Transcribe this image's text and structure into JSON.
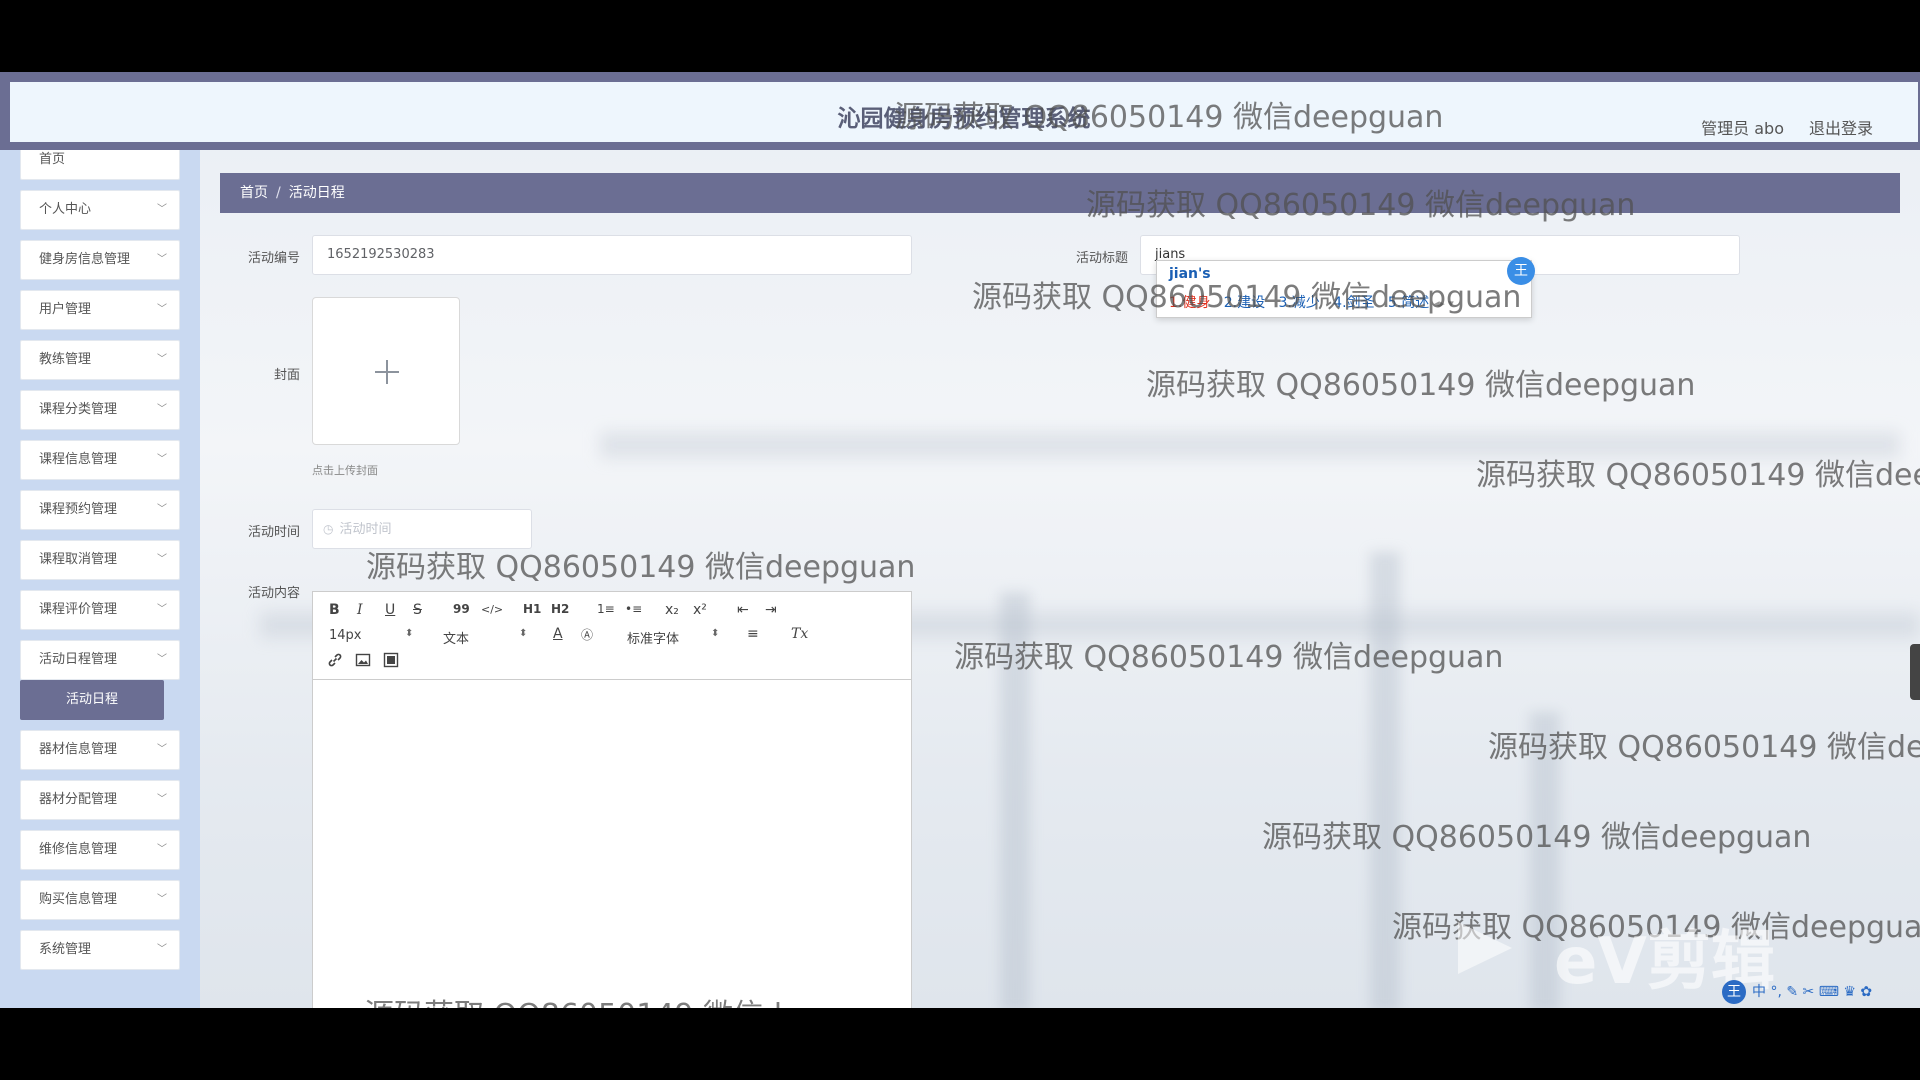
{
  "header": {
    "title": "沁园健身房预约管理系统",
    "user": "管理员 abo",
    "logout": "退出登录"
  },
  "sidebar": {
    "items": [
      {
        "label": "首页"
      },
      {
        "label": "个人中心"
      },
      {
        "label": "健身房信息管理"
      },
      {
        "label": "用户管理"
      },
      {
        "label": "教练管理"
      },
      {
        "label": "课程分类管理"
      },
      {
        "label": "课程信息管理"
      },
      {
        "label": "课程预约管理"
      },
      {
        "label": "课程取消管理"
      },
      {
        "label": "课程评价管理"
      },
      {
        "label": "活动日程管理"
      },
      {
        "label": "器材信息管理"
      },
      {
        "label": "器材分配管理"
      },
      {
        "label": "维修信息管理"
      },
      {
        "label": "购买信息管理"
      },
      {
        "label": "系统管理"
      }
    ],
    "active_sub": "活动日程"
  },
  "breadcrumb": {
    "home": "首页",
    "sep": "/",
    "current": "活动日程"
  },
  "form": {
    "id_label": "活动编号",
    "id_value": "1652192530283",
    "title_label": "活动标题",
    "title_value": "jians",
    "cover_label": "封面",
    "cover_hint": "点击上传封面",
    "time_label": "活动时间",
    "time_placeholder": "活动时间",
    "content_label": "活动内容"
  },
  "editor": {
    "font_size": "14px",
    "block_format": "文本",
    "font_family": "标准字体",
    "tools": [
      "B",
      "I",
      "U",
      "S",
      "99",
      "</>",
      "H1",
      "H2",
      "1≡",
      "•≡",
      "x₂",
      "x²",
      "⇤",
      "⇥",
      "A",
      "Ⓐ",
      "≡",
      "Tx",
      "link",
      "image",
      "video"
    ]
  },
  "ime": {
    "pinyin": "jian's",
    "candidates": [
      "1.健身",
      "2.建设",
      "3.减少",
      "4.剑圣",
      "5.简述"
    ],
    "badge": "王",
    "bar": "中 °, ✎ ✂ ⌨ ♛ ✿"
  },
  "watermark": "源码获取 QQ86050149 微信deepguan",
  "overlay_logo": "eV剪辑",
  "colors": {
    "accent": "#6b6e93",
    "sidebar_bg": "#c9d9f1",
    "header_inner": "#eef6fd"
  }
}
